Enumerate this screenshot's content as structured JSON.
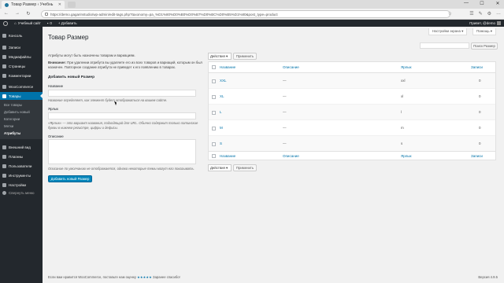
{
  "browser": {
    "tab_title": "Товар Размер ‹ Учебнь",
    "tab_close": "✕",
    "url": "https://demo.gagarinstudio/wp-admin/edit-tags.php?taxonomy=pa_%D1%80%D0%B0%D0%B7%D0%BC%D0%B5%D1%80&post_type=product",
    "star": "☆",
    "back": "←",
    "forward": "→",
    "reload": "↻",
    "window_controls": [
      "—",
      "☐",
      "✕"
    ],
    "toolbar_icons": [
      "☰",
      "✎",
      "⚙",
      "…"
    ]
  },
  "adminbar": {
    "site_name": "Учебный сайт",
    "comments_count": "0",
    "new_label": "+ Добавить",
    "greeting": "Привет, @demo"
  },
  "sidebar": {
    "items": [
      {
        "label": "Консоль"
      },
      {
        "label": "Записи"
      },
      {
        "label": "Медиафайлы"
      },
      {
        "label": "Страницы"
      },
      {
        "label": "Комментарии"
      },
      {
        "label": "WooCommerce"
      },
      {
        "label": "Товары"
      },
      {
        "label": "Внешний вид"
      },
      {
        "label": "Плагины"
      },
      {
        "label": "Пользователи"
      },
      {
        "label": "Инструменты"
      },
      {
        "label": "Настройки"
      },
      {
        "label": "Свернуть меню"
      }
    ],
    "submenu": [
      "Все товары",
      "Добавить новый",
      "Категории",
      "Метки",
      "Атрибуты"
    ]
  },
  "screen": {
    "options": "Настройки экрана ▾",
    "help": "Помощь ▾"
  },
  "page": {
    "title": "Товар Размер",
    "search_button": "Поиск Размер",
    "intro": "Атрибуты могут быть назначены товарам и вариациям.",
    "warning_bold": "Внимание:",
    "warning_1": " При удалении атрибута вы удаляете его из всех товаров и вариаций, которым он был",
    "warning_2": "назначен. Повторное создание атрибута не приведет к его появлению в товарах."
  },
  "form": {
    "heading": "Добавить новый Размер",
    "name_label": "Название",
    "name_hint": "Название определяет, как элемент будет отображаться на вашем сайте.",
    "slug_label": "Ярлык",
    "slug_hint_1": "«Ярлык» — это вариант названия, подходящий для URL. Обычно содержит только латинские",
    "slug_hint_2": "буквы в нижнем регистре, цифры и дефисы.",
    "desc_label": "Описание",
    "desc_hint": "Описание по умолчанию не отображается, однако некоторые темы могут его показывать.",
    "submit": "Добавить новый Размер"
  },
  "table": {
    "bulk_label": "Действия ▾",
    "apply": "Применить",
    "columns": [
      "Название",
      "Описание",
      "Ярлык",
      "Записи"
    ],
    "rows": [
      {
        "name": "XXL",
        "desc": "—",
        "slug": "xxl",
        "count": "0"
      },
      {
        "name": "XL",
        "desc": "—",
        "slug": "xl",
        "count": "0"
      },
      {
        "name": "L",
        "desc": "—",
        "slug": "l",
        "count": "0"
      },
      {
        "name": "M",
        "desc": "—",
        "slug": "m",
        "count": "0"
      },
      {
        "name": "S",
        "desc": "—",
        "slug": "s",
        "count": "0"
      }
    ]
  },
  "footer": {
    "text": "Если вам нравится WooCommerce, поставьте нам оценку",
    "stars": "★★★★★",
    "thanks": "Заранее спасибо!",
    "version": "Версия 4.9.5"
  },
  "colors": {
    "accent": "#0073aa",
    "admin_dark": "#23282d",
    "primary_button": "#0085ba"
  }
}
